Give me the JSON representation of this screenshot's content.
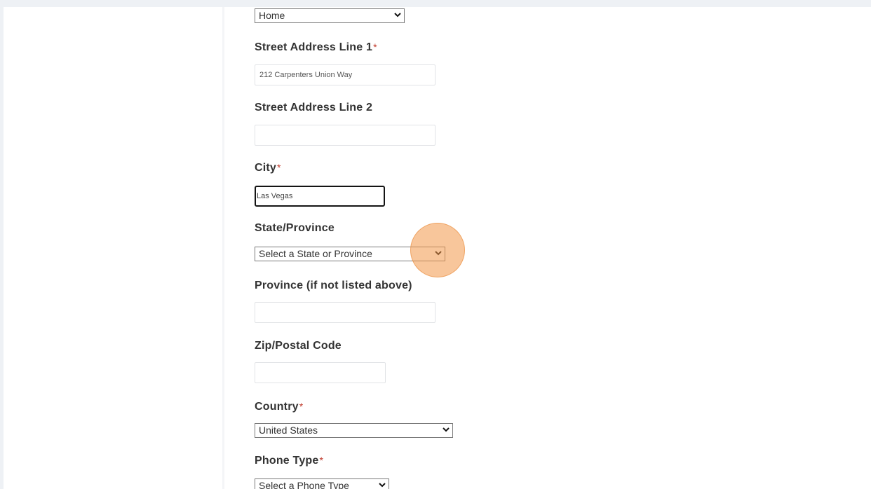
{
  "address_type": {
    "selected": "Home"
  },
  "street1": {
    "label": "Street Address Line 1",
    "required_mark": "*",
    "value": "212 Carpenters Union Way"
  },
  "street2": {
    "label": "Street Address Line 2",
    "value": ""
  },
  "city": {
    "label": "City",
    "required_mark": "*",
    "value": "Las Vegas"
  },
  "state": {
    "label": "State/Province",
    "selected": "Select a State or Province"
  },
  "province": {
    "label": "Province (if not listed above)",
    "value": ""
  },
  "zip": {
    "label": "Zip/Postal Code",
    "value": ""
  },
  "country": {
    "label": "Country",
    "required_mark": "*",
    "selected": "United States"
  },
  "phone_type": {
    "label": "Phone Type",
    "required_mark": "*",
    "selected": "Select a Phone Type"
  },
  "colors": {
    "background": "#eef1f5",
    "required_mark": "#c0392b",
    "click_indicator": "#f39848"
  },
  "icons": {
    "dropdown": "chevron-down-icon"
  }
}
